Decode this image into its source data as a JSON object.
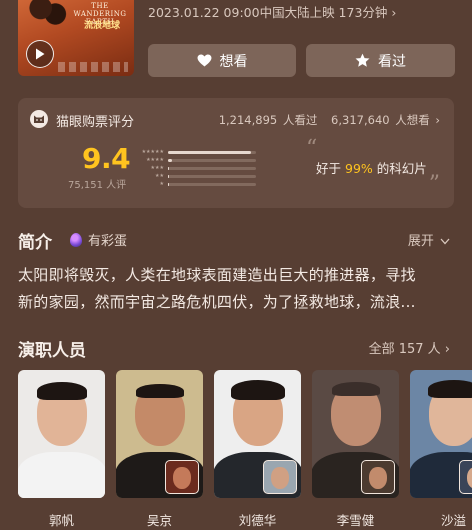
{
  "movie": {
    "poster": {
      "title_en": "THE WANDERING EARTH",
      "title_cn": "流浪地球"
    },
    "release_info": "2023.01.22 09:00中国大陆上映 173分钟",
    "release_chevron": "›",
    "want_label": "想看",
    "seen_label": "看过"
  },
  "rating": {
    "label": "猫眼购票评分",
    "viewers_count": "1,214,895",
    "viewers_suffix": "人看过",
    "want_count": "6,317,640",
    "want_suffix": "人想看",
    "score": "9.4",
    "score_count": "75,151 人评",
    "distribution": [
      0.94,
      0.04,
      0.01,
      0.005,
      0.005
    ],
    "quote_prefix": "好于",
    "quote_highlight": "99%",
    "quote_suffix": "的科幻片",
    "colors": {
      "accent": "#ffc41f"
    }
  },
  "intro": {
    "title": "简介",
    "egg_label": "有彩蛋",
    "expand_label": "展开",
    "synopsis_lines": [
      "太阳即将毁灭，人类在地球表面建造出巨大的推进器，寻找",
      "新的家园，然而宇宙之路危机四伏，为了拯救地球，流浪..."
    ]
  },
  "cast": {
    "title": "演职人员",
    "all_label": "全部 157 人",
    "members": [
      {
        "name": "郭帆",
        "has_role_thumb": false
      },
      {
        "name": "吴京",
        "has_role_thumb": true
      },
      {
        "name": "刘德华",
        "has_role_thumb": true
      },
      {
        "name": "李雪健",
        "has_role_thumb": true
      },
      {
        "name": "沙溢",
        "has_role_thumb": true
      }
    ]
  }
}
